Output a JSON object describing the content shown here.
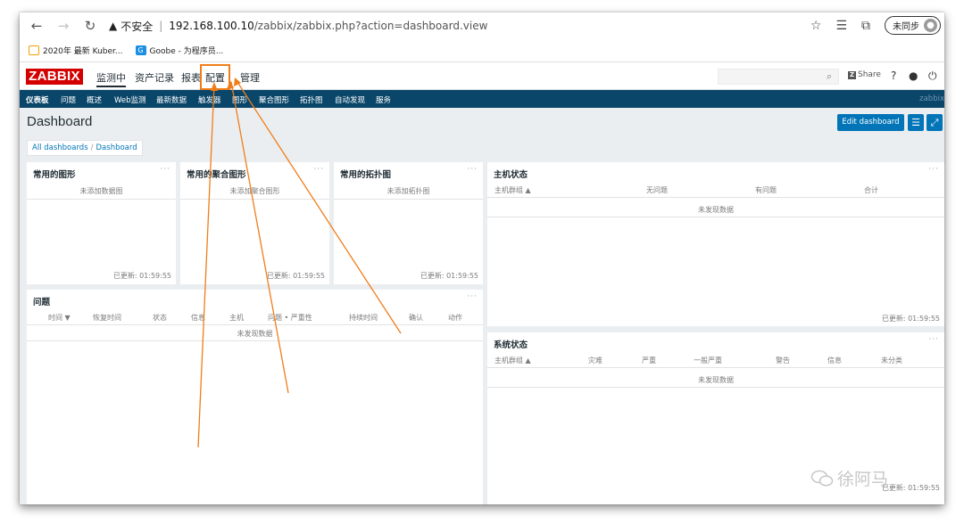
{
  "browser": {
    "nav": {
      "back": "←",
      "forward": "→",
      "reload": "↻"
    },
    "security_label": "不安全",
    "url_host": "192.168.100.10",
    "url_path": "/zabbix/zabbix.php?action=dashboard.view",
    "sync_label": "未同步",
    "bookmarks": [
      {
        "label": "2020年 最新 Kuber...",
        "icon": "tv-icon"
      },
      {
        "label": "Goobe - 为程序员...",
        "icon": "g-icon"
      }
    ]
  },
  "zabbix": {
    "logo": "ZABBIX",
    "menu": [
      "监测中",
      "资产记录",
      "报表",
      "配置",
      "管理"
    ],
    "share_label": "Share",
    "help_icon": "?",
    "submenu": [
      "仪表板",
      "问题",
      "概述",
      "Web监测",
      "最新数据",
      "触发器",
      "图形",
      "聚合图形",
      "拓扑图",
      "自动发现",
      "服务"
    ],
    "submenu_right": "zabbix"
  },
  "dashboard": {
    "title": "Dashboard",
    "edit_button": "Edit dashboard",
    "breadcrumb": [
      "All dashboards",
      "Dashboard"
    ]
  },
  "widgets": {
    "graphs": {
      "title": "常用的图形",
      "empty": "未添加数据图",
      "updated": "已更新: 01:59:55"
    },
    "screens": {
      "title": "常用的聚合图形",
      "empty": "未添加聚合图形",
      "updated": "已更新: 01:59:55"
    },
    "maps": {
      "title": "常用的拓扑图",
      "empty": "未添加拓扑图",
      "updated": "已更新: 01:59:55"
    },
    "problems": {
      "title": "问题",
      "columns": [
        "时间 ▼",
        "恢复时间",
        "状态",
        "信息",
        "主机",
        "问题 • 严重性",
        "持续时间",
        "确认",
        "动作"
      ],
      "empty": "未发现数据"
    },
    "host_status": {
      "title": "主机状态",
      "columns": [
        "主机群组 ▲",
        "无问题",
        "有问题",
        "合计"
      ],
      "empty": "未发现数据",
      "updated": "已更新: 01:59:55"
    },
    "system_status": {
      "title": "系统状态",
      "columns": [
        "主机群组 ▲",
        "灾难",
        "严重",
        "一般严重",
        "警告",
        "信息",
        "未分类"
      ],
      "empty": "未发现数据",
      "updated": "已更新: 01:59:55"
    },
    "dots": "···"
  },
  "watermark": "徐阿马",
  "colors": {
    "zabbix_red": "#d40000",
    "submenu_bg": "#0a466a",
    "button_blue": "#0275b8",
    "annotation_orange": "#f07d1a"
  }
}
